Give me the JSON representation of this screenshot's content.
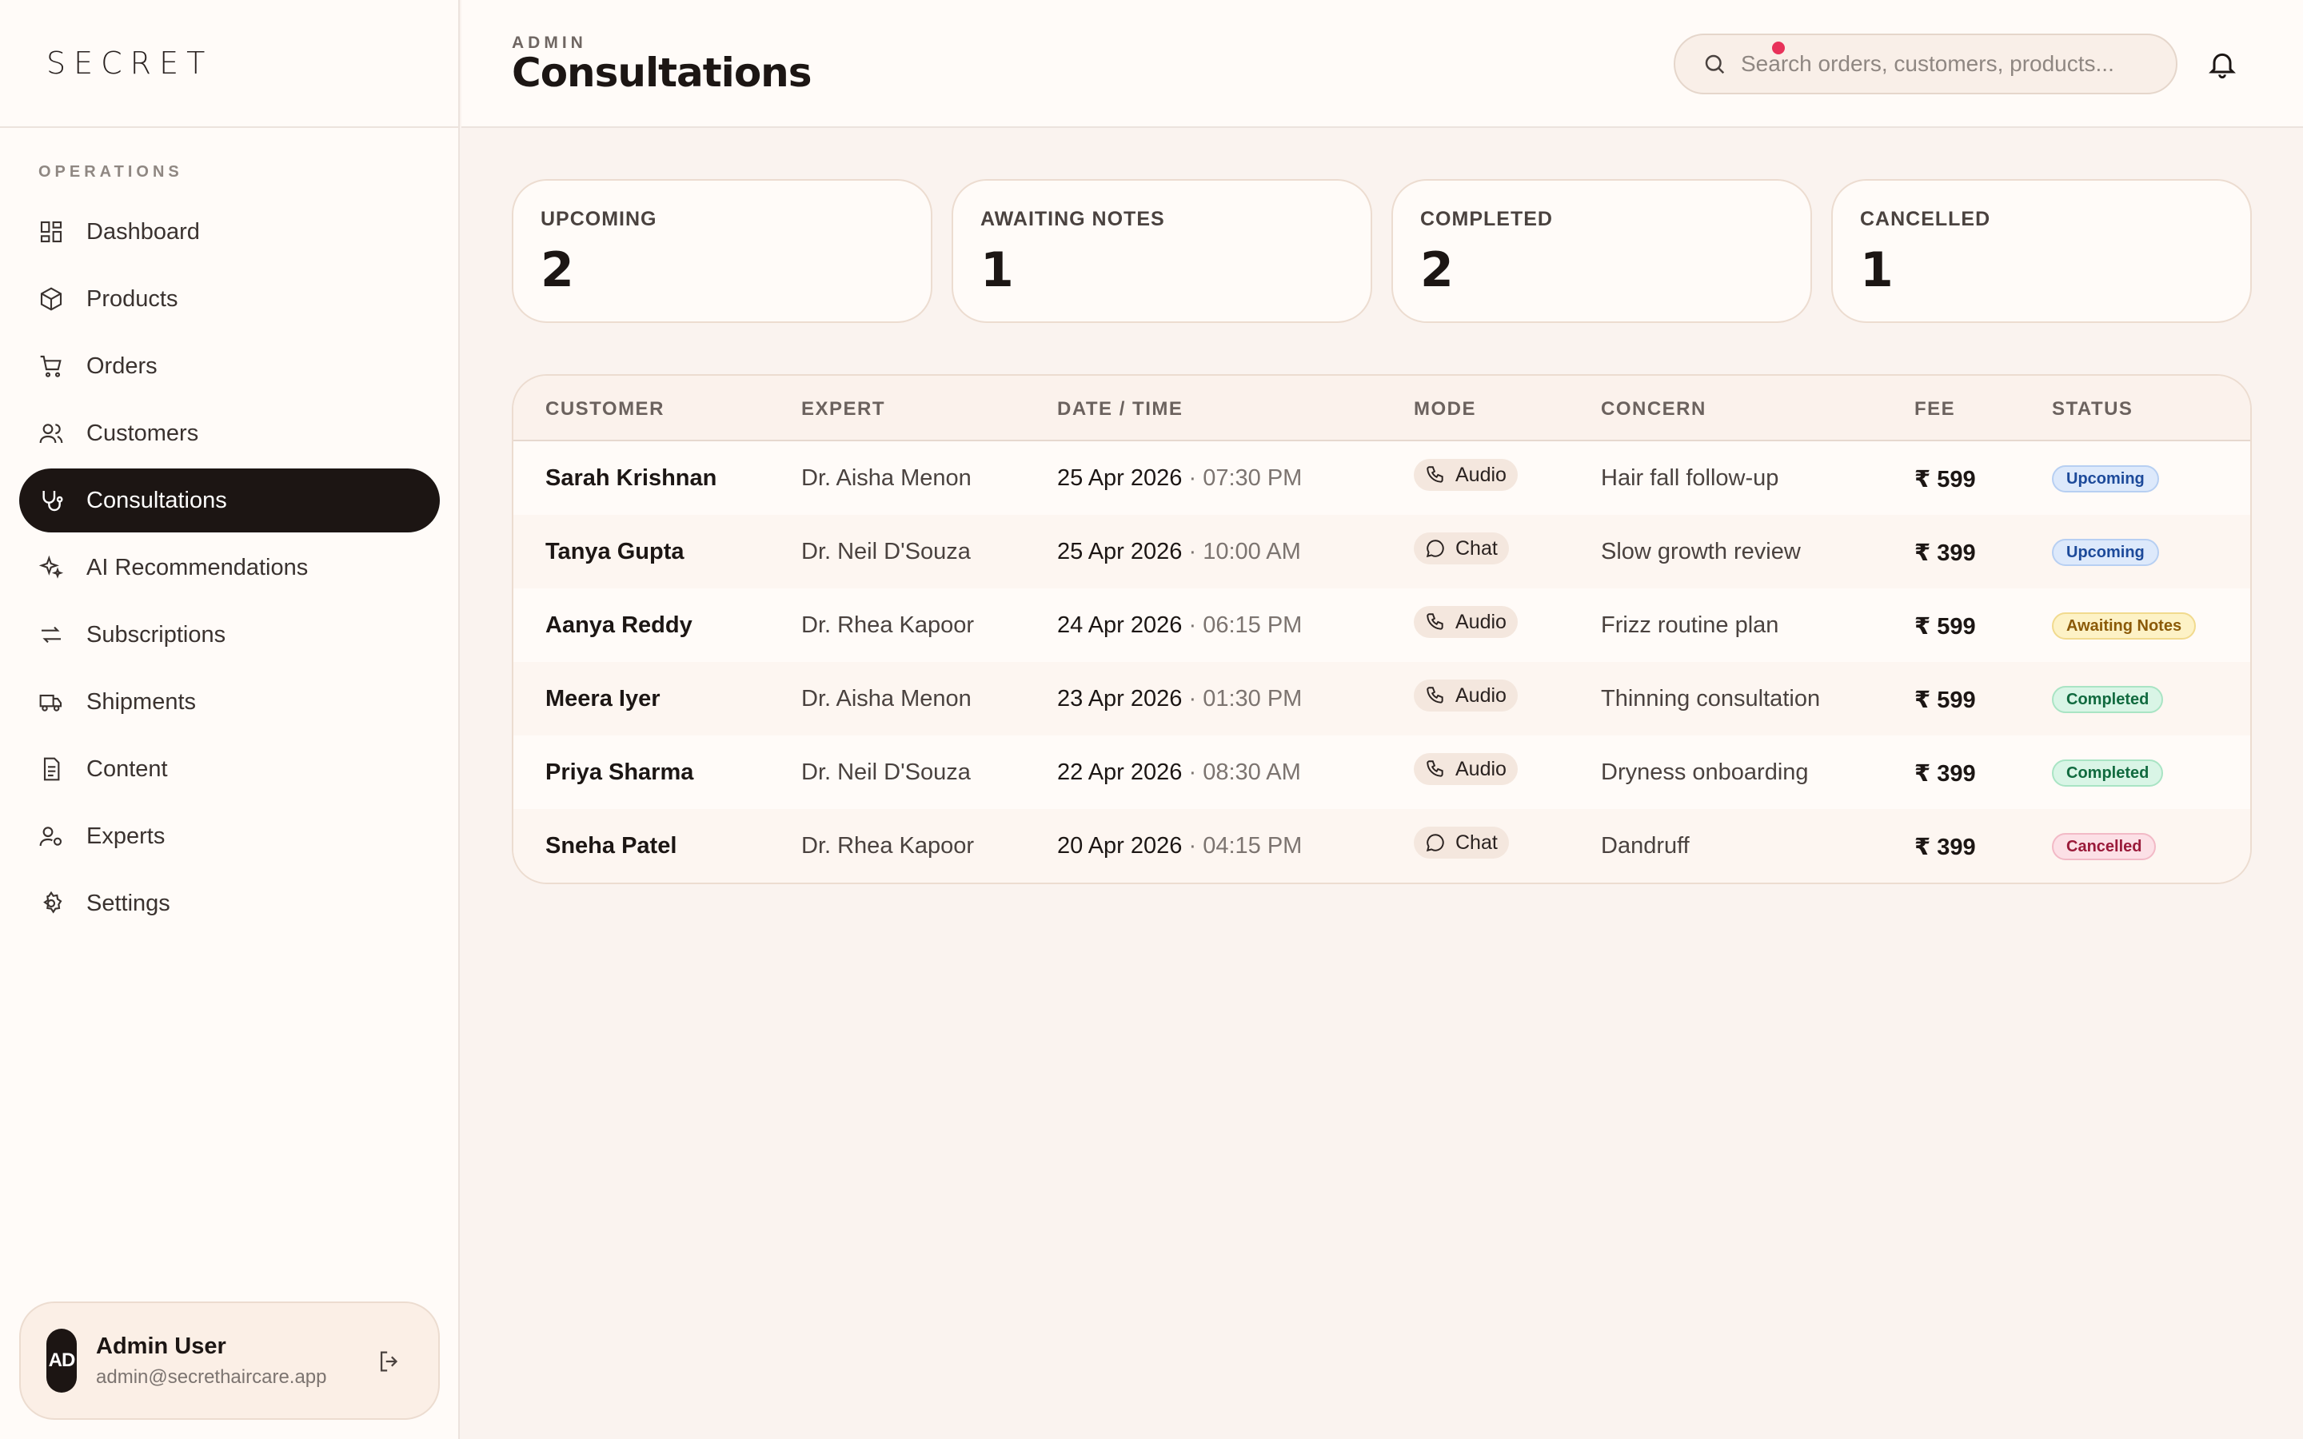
{
  "brand": "SECRET",
  "sidebar": {
    "section": "OPERATIONS",
    "items": [
      {
        "label": "Dashboard"
      },
      {
        "label": "Products"
      },
      {
        "label": "Orders"
      },
      {
        "label": "Customers"
      },
      {
        "label": "Consultations"
      },
      {
        "label": "AI Recommendations"
      },
      {
        "label": "Subscriptions"
      },
      {
        "label": "Shipments"
      },
      {
        "label": "Content"
      },
      {
        "label": "Experts"
      },
      {
        "label": "Settings"
      }
    ],
    "active": "Consultations"
  },
  "user": {
    "initials": "AD",
    "name": "Admin User",
    "email": "admin@secrethaircare.app"
  },
  "header": {
    "kicker": "ADMIN",
    "title": "Consultations",
    "search_placeholder": "Search orders, customers, products..."
  },
  "stats": [
    {
      "label": "UPCOMING",
      "value": "2"
    },
    {
      "label": "AWAITING NOTES",
      "value": "1"
    },
    {
      "label": "COMPLETED",
      "value": "2"
    },
    {
      "label": "CANCELLED",
      "value": "1"
    }
  ],
  "table": {
    "columns": [
      "CUSTOMER",
      "EXPERT",
      "DATE / TIME",
      "MODE",
      "CONCERN",
      "FEE",
      "STATUS"
    ],
    "rows": [
      {
        "customer": "Sarah Krishnan",
        "expert": "Dr. Aisha Menon",
        "date": "25 Apr 2026",
        "time": "07:30 PM",
        "mode": "Audio",
        "concern": "Hair fall follow-up",
        "fee": "₹ 599",
        "status": "Upcoming"
      },
      {
        "customer": "Tanya Gupta",
        "expert": "Dr. Neil D'Souza",
        "date": "25 Apr 2026",
        "time": "10:00 AM",
        "mode": "Chat",
        "concern": "Slow growth review",
        "fee": "₹ 399",
        "status": "Upcoming"
      },
      {
        "customer": "Aanya Reddy",
        "expert": "Dr. Rhea Kapoor",
        "date": "24 Apr 2026",
        "time": "06:15 PM",
        "mode": "Audio",
        "concern": "Frizz routine plan",
        "fee": "₹ 599",
        "status": "Awaiting Notes"
      },
      {
        "customer": "Meera Iyer",
        "expert": "Dr. Aisha Menon",
        "date": "23 Apr 2026",
        "time": "01:30 PM",
        "mode": "Audio",
        "concern": "Thinning consultation",
        "fee": "₹ 599",
        "status": "Completed"
      },
      {
        "customer": "Priya Sharma",
        "expert": "Dr. Neil D'Souza",
        "date": "22 Apr 2026",
        "time": "08:30 AM",
        "mode": "Audio",
        "concern": "Dryness onboarding",
        "fee": "₹ 399",
        "status": "Completed"
      },
      {
        "customer": "Sneha Patel",
        "expert": "Dr. Rhea Kapoor",
        "date": "20 Apr 2026",
        "time": "04:15 PM",
        "mode": "Chat",
        "concern": "Dandruff",
        "fee": "₹ 399",
        "status": "Cancelled"
      }
    ]
  },
  "icons": {
    "nav": [
      "dashboard-icon",
      "products-icon",
      "orders-icon",
      "customers-icon",
      "consultations-icon",
      "ai-recommendations-icon",
      "subscriptions-icon",
      "shipments-icon",
      "content-icon",
      "experts-icon",
      "settings-icon"
    ],
    "search": "search-icon",
    "notifications": "bell-icon",
    "logout": "logout-icon",
    "mode_audio": "phone-icon",
    "mode_chat": "chat-icon"
  },
  "colors": {
    "accent": "#1c1513",
    "notification_dot": "#e8325a",
    "upcoming": "#1d4a9a",
    "awaiting_notes": "#8b5a08",
    "completed": "#116a3f",
    "cancelled": "#9a1a3a"
  }
}
